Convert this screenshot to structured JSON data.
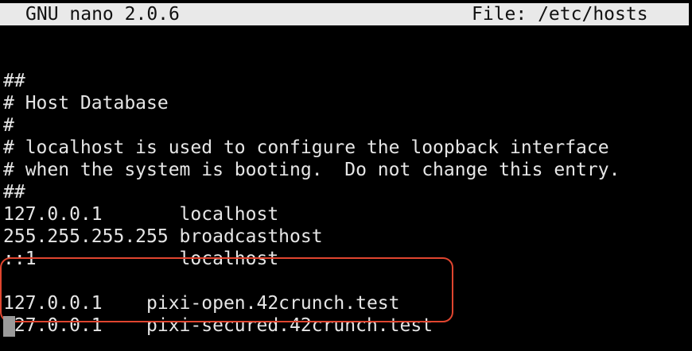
{
  "titlebar": {
    "app_version": "GNU nano 2.0.6",
    "file_label": "File: /etc/hosts"
  },
  "editor": {
    "lines": [
      "",
      "##",
      "# Host Database",
      "#",
      "# localhost is used to configure the loopback interface",
      "# when the system is booting.  Do not change this entry.",
      "##",
      "127.0.0.1       localhost",
      "255.255.255.255 broadcasthost",
      "::1             localhost",
      "",
      "127.0.0.1    pixi-open.42crunch.test",
      "127.0.0.1    pixi-secured.42crunch.test",
      ""
    ]
  },
  "colors": {
    "background": "#000000",
    "text": "#e6e6e6",
    "titlebar_bg": "#e9e9e9",
    "highlight_border": "#e0452f",
    "cursor": "#9a9a9a"
  }
}
